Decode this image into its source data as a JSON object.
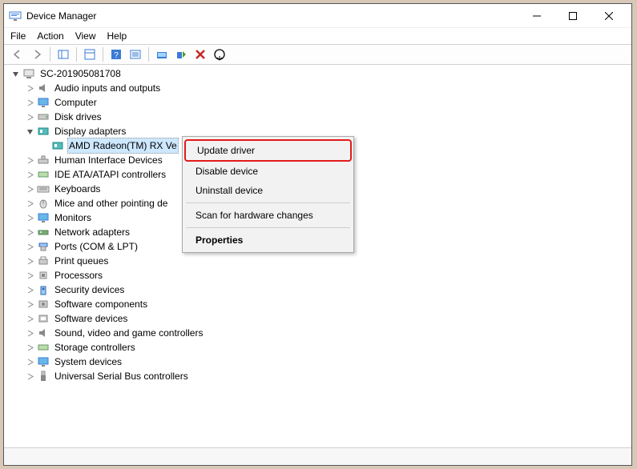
{
  "window": {
    "title": "Device Manager"
  },
  "menubar": {
    "file": "File",
    "action": "Action",
    "view": "View",
    "help": "Help"
  },
  "tree": {
    "root": "SC-201905081708",
    "items": {
      "audio": "Audio inputs and outputs",
      "computer": "Computer",
      "disk": "Disk drives",
      "display": "Display adapters",
      "display_child": "AMD Radeon(TM) RX Ve",
      "hid": "Human Interface Devices",
      "ide": "IDE ATA/ATAPI controllers",
      "keyboards": "Keyboards",
      "mice": "Mice and other pointing de",
      "monitors": "Monitors",
      "network": "Network adapters",
      "ports": "Ports (COM & LPT)",
      "printq": "Print queues",
      "processors": "Processors",
      "security": "Security devices",
      "softcomp": "Software components",
      "softdev": "Software devices",
      "sound": "Sound, video and game controllers",
      "storage": "Storage controllers",
      "sysdev": "System devices",
      "usb": "Universal Serial Bus controllers"
    }
  },
  "context_menu": {
    "update": "Update driver",
    "disable": "Disable device",
    "uninstall": "Uninstall device",
    "scan": "Scan for hardware changes",
    "properties": "Properties"
  }
}
